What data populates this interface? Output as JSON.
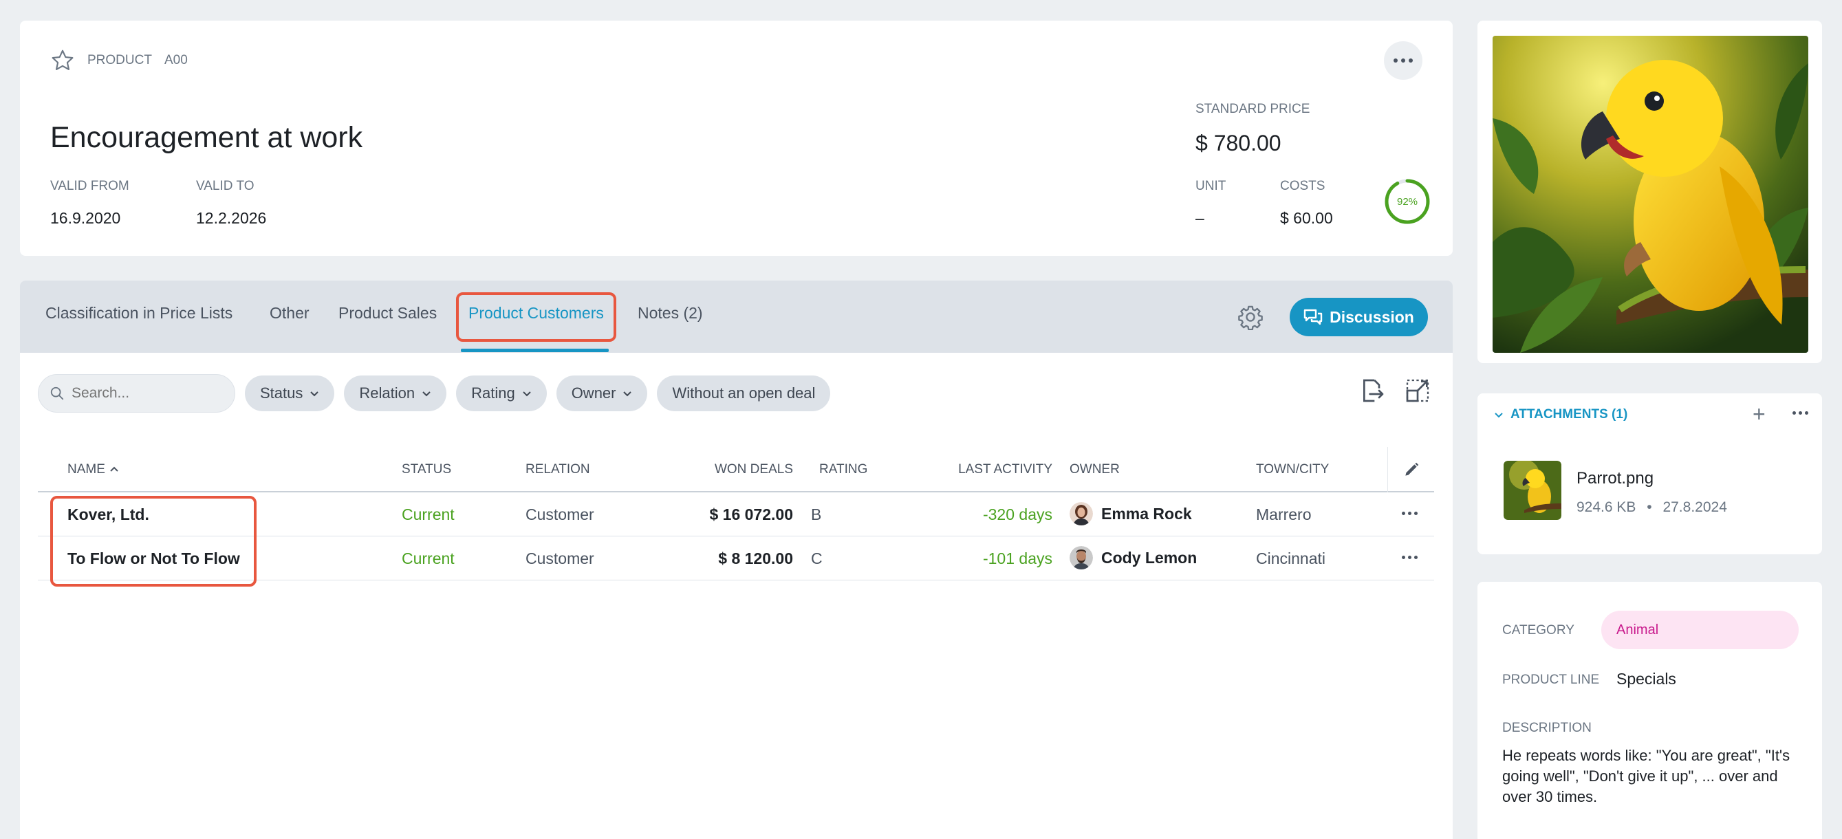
{
  "header": {
    "type_label": "PRODUCT",
    "code": "A00",
    "title": "Encouragement at work",
    "valid_from_label": "VALID FROM",
    "valid_from": "16.9.2020",
    "valid_to_label": "VALID TO",
    "valid_to": "12.2.2026",
    "standard_price_label": "STANDARD PRICE",
    "standard_price": "$ 780.00",
    "unit_label": "UNIT",
    "unit": "–",
    "costs_label": "COSTS",
    "costs": "$ 60.00",
    "progress_percent": 92,
    "progress_text": "92%",
    "progress_color": "#4aa220"
  },
  "tabs": [
    {
      "label": "Classification in Price Lists"
    },
    {
      "label": "Other"
    },
    {
      "label": "Product Sales"
    },
    {
      "label": "Product Customers",
      "active": true
    },
    {
      "label": "Notes (2)"
    }
  ],
  "discussion_label": "Discussion",
  "filters": {
    "search_placeholder": "Search...",
    "chips": [
      "Status",
      "Relation",
      "Rating",
      "Owner",
      "Without an open deal"
    ]
  },
  "table": {
    "columns": {
      "name": "NAME",
      "status": "STATUS",
      "relation": "RELATION",
      "won_deals": "WON DEALS",
      "rating": "RATING",
      "last_activity": "LAST ACTIVITY",
      "owner": "OWNER",
      "town": "TOWN/CITY"
    },
    "rows": [
      {
        "name": "Kover, Ltd.",
        "status": "Current",
        "relation": "Customer",
        "won_deals": "$ 16 072.00",
        "rating": "B",
        "last_activity": "-320 days",
        "owner": "Emma Rock",
        "town": "Marrero"
      },
      {
        "name": "To Flow or Not To Flow",
        "status": "Current",
        "relation": "Customer",
        "won_deals": "$ 8 120.00",
        "rating": "C",
        "last_activity": "-101 days",
        "owner": "Cody Lemon",
        "town": "Cincinnati"
      }
    ]
  },
  "attachments": {
    "title": "ATTACHMENTS (1)",
    "file_name": "Parrot.png",
    "file_size": "924.6 KB",
    "file_date": "27.8.2024"
  },
  "info": {
    "category_label": "CATEGORY",
    "category": "Animal",
    "product_line_label": "PRODUCT LINE",
    "product_line": "Specials",
    "description_label": "DESCRIPTION",
    "description": "He repeats words like: \"You are great\", \"It's going well\", \"Don't give it up\", ... over and over 30 times."
  },
  "colors": {
    "accent": "#1795c4",
    "highlight": "#e8573f",
    "status_green": "#4aa220",
    "category_pink": "#c8198c"
  }
}
